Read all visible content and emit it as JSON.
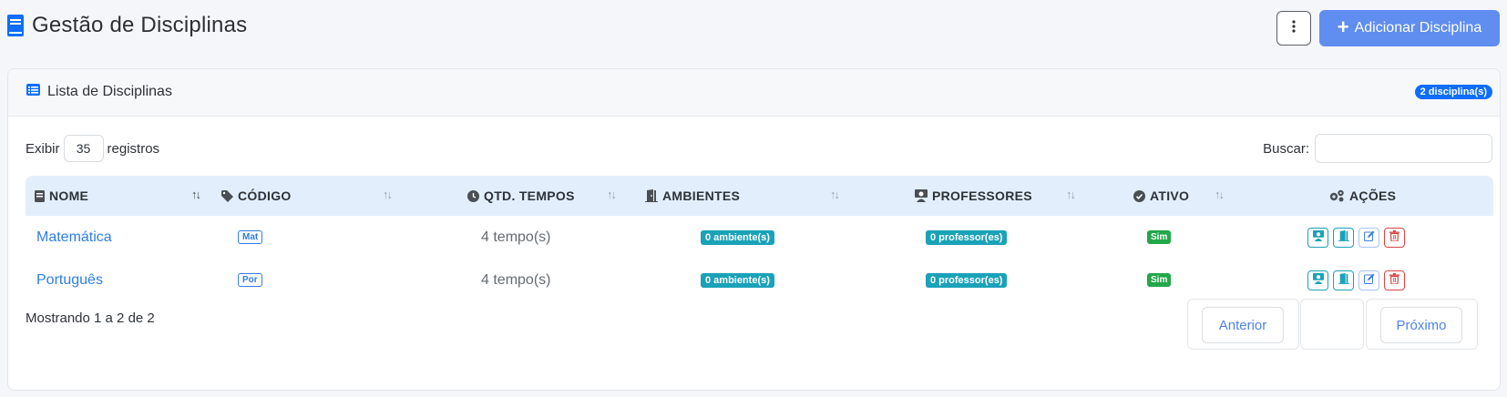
{
  "header": {
    "title": "Gestão de Disciplinas",
    "add_button_label": "Adicionar Disciplina",
    "title_icon": "book-icon",
    "menu_icon": "vertical-dots-icon"
  },
  "card": {
    "title": "Lista de Disciplinas",
    "title_icon": "list-icon",
    "count_badge": "2 disciplina(s)"
  },
  "controls": {
    "show_prefix": "Exibir",
    "show_value": "35",
    "show_suffix": "registros",
    "search_label": "Buscar:",
    "search_value": ""
  },
  "table": {
    "columns": [
      {
        "label": "NOME",
        "icon": "book-icon"
      },
      {
        "label": "CÓDIGO",
        "icon": "tag-icon"
      },
      {
        "label": "QTD. TEMPOS",
        "icon": "clock-icon"
      },
      {
        "label": "AMBIENTES",
        "icon": "door-icon"
      },
      {
        "label": "PROFESSORES",
        "icon": "teacher-icon"
      },
      {
        "label": "ATIVO",
        "icon": "check-circle-icon"
      },
      {
        "label": "AÇÕES",
        "icon": "gears-icon"
      }
    ],
    "rows": [
      {
        "name": "Matemática",
        "code": "Mat",
        "tempos": "4 tempo(s)",
        "ambientes": "0 ambiente(s)",
        "professores": "0 professor(es)",
        "ativo": "Sim"
      },
      {
        "name": "Português",
        "code": "Por",
        "tempos": "4 tempo(s)",
        "ambientes": "0 ambiente(s)",
        "professores": "0 professor(es)",
        "ativo": "Sim"
      }
    ]
  },
  "footer": {
    "info": "Mostrando 1 a 2 de 2",
    "prev_label": "Anterior",
    "next_label": "Próximo"
  },
  "colors": {
    "primary": "#5f8df0",
    "link": "#2f7fe0",
    "teal": "#1aa2b8",
    "success": "#22a749",
    "danger": "#d64545",
    "table_header_bg": "#e2eefb"
  }
}
